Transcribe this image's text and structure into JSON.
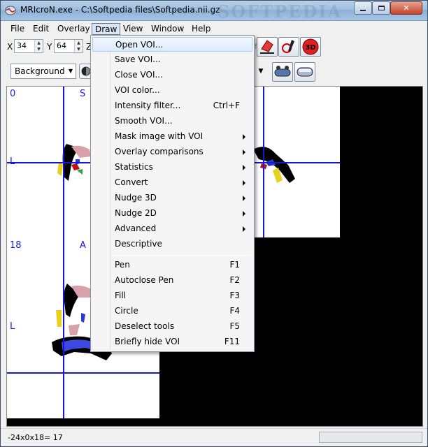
{
  "window": {
    "title": "MRIcroN.exe - C:\\Softpedia files\\Softpedia.nii.gz",
    "watermark": "SOFTPEDIA"
  },
  "menubar": {
    "items": [
      "File",
      "Edit",
      "Overlay",
      "Draw",
      "View",
      "Window",
      "Help"
    ]
  },
  "coords": {
    "x_label": "X",
    "x_value": "34",
    "y_label": "Y",
    "y_value": "64",
    "z_label": "Z",
    "obscured_text": "ftped"
  },
  "toolbar2": {
    "background_select": "Background"
  },
  "slices": [
    {
      "label": "0",
      "orientation": "S",
      "side": "L"
    },
    {
      "label": "18",
      "orientation": "A",
      "side": "L"
    }
  ],
  "status": {
    "text": "-24x0x18= 17"
  },
  "draw_menu": {
    "items": [
      {
        "label": "Open VOI...",
        "shortcut": "",
        "submenu": false,
        "highlighted": true
      },
      {
        "label": "Save VOI...",
        "shortcut": "",
        "submenu": false
      },
      {
        "label": "Close VOI...",
        "shortcut": "",
        "submenu": false
      },
      {
        "label": "VOI color...",
        "shortcut": "",
        "submenu": false
      },
      {
        "label": "Intensity filter...",
        "shortcut": "Ctrl+F",
        "submenu": false
      },
      {
        "label": "Smooth VOI...",
        "shortcut": "",
        "submenu": false
      },
      {
        "label": "Mask image with VOI",
        "shortcut": "",
        "submenu": true
      },
      {
        "label": "Overlay comparisons",
        "shortcut": "",
        "submenu": true
      },
      {
        "label": "Statistics",
        "shortcut": "",
        "submenu": true
      },
      {
        "label": "Convert",
        "shortcut": "",
        "submenu": true
      },
      {
        "label": "Nudge 3D",
        "shortcut": "",
        "submenu": true
      },
      {
        "label": "Nudge 2D",
        "shortcut": "",
        "submenu": true
      },
      {
        "label": "Advanced",
        "shortcut": "",
        "submenu": true
      },
      {
        "label": "Descriptive",
        "shortcut": "",
        "submenu": false
      }
    ],
    "tools": [
      {
        "label": "Pen",
        "shortcut": "F1"
      },
      {
        "label": "Autoclose Pen",
        "shortcut": "F2"
      },
      {
        "label": "Fill",
        "shortcut": "F3"
      },
      {
        "label": "Circle",
        "shortcut": "F4"
      },
      {
        "label": "Deselect tools",
        "shortcut": "F5"
      },
      {
        "label": "Briefly hide VOI",
        "shortcut": "F11"
      }
    ]
  },
  "colors": {
    "crosshair": "#1616d8",
    "label": "#1a1ae0",
    "menu_highlight": "#dcebfc"
  }
}
